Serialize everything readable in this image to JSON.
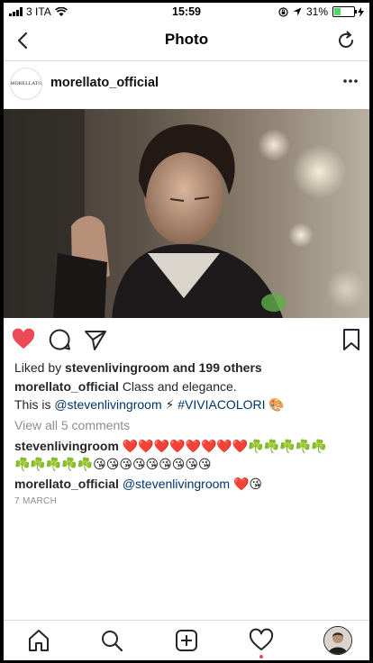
{
  "status_bar": {
    "carrier": "3 ITA",
    "time": "15:59",
    "battery": "31%",
    "battery_level": 0.31
  },
  "nav": {
    "title": "Photo"
  },
  "post": {
    "username": "morellato_official",
    "avatar_text": "MORELLATO",
    "liked_by_prefix": "Liked by",
    "liked_by_user": "stevenlivingroom",
    "liked_by_suffix": "and 199 others",
    "caption_user": "morellato_official",
    "caption_text_1": "Class and elegance.",
    "caption_text_2_prefix": "This is",
    "caption_mention": "@stevenlivingroom",
    "caption_emoji_1": "⚡",
    "caption_hashtag": "#VIVIACOLORI",
    "caption_emoji_2": "🎨",
    "view_comments": "View all 5 comments",
    "comments": [
      {
        "user": "stevenlivingroom",
        "text_line1": "❤️❤️❤️❤️❤️❤️❤️❤️☘️☘️☘️☘️☘️",
        "text_line2": "☘️☘️☘️☘️☘️😘😘😘😘😘😘😘😘😘"
      },
      {
        "user": "morellato_official",
        "mention": "@stevenlivingroom",
        "emoji": "❤️😘"
      }
    ],
    "date": "7 MARCH"
  },
  "tabs": [
    "home",
    "search",
    "new-post",
    "activity",
    "profile"
  ],
  "colors": {
    "like_red": "#ed4956",
    "link_blue": "#003569",
    "muted": "#8e8e8e"
  }
}
